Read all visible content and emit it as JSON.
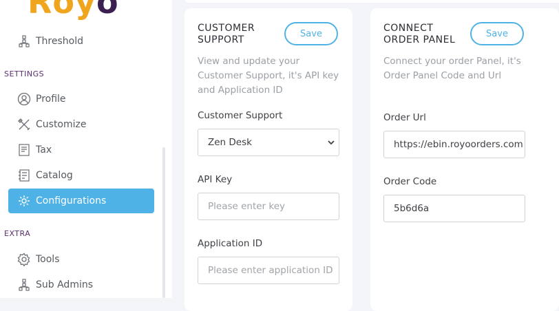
{
  "sidebar": {
    "logo": {
      "text_main": "Roy",
      "text_end": "o"
    },
    "items_top": [
      {
        "label": "Threshold",
        "icon": "threshold-icon"
      }
    ],
    "settings_title": "SETTINGS",
    "settings_items": [
      {
        "label": "Profile",
        "icon": "profile-icon"
      },
      {
        "label": "Customize",
        "icon": "customize-icon"
      },
      {
        "label": "Tax",
        "icon": "tax-icon"
      },
      {
        "label": "Catalog",
        "icon": "catalog-icon"
      },
      {
        "label": "Configurations",
        "icon": "configurations-icon",
        "active": true
      }
    ],
    "extra_title": "EXTRA",
    "extra_items": [
      {
        "label": "Tools",
        "icon": "tools-icon"
      },
      {
        "label": "Sub Admins",
        "icon": "sub-admins-icon"
      }
    ]
  },
  "customer_support": {
    "title": "CUSTOMER SUPPORT",
    "save_label": "Save",
    "description": "View and update your Customer Support, it's API key and Application ID",
    "support_label": "Customer Support",
    "support_value": "Zen Desk",
    "api_key_label": "API Key",
    "api_key_placeholder": "Please enter key",
    "app_id_label": "Application ID",
    "app_id_placeholder": "Please enter application ID"
  },
  "order_panel": {
    "title": "CONNECT ORDER PANEL",
    "save_label": "Save",
    "description": "Connect your order Panel, it's Order Panel Code and Url",
    "order_url_label": "Order Url",
    "order_url_value": "https://ebin.royoorders.com",
    "order_code_label": "Order Code",
    "order_code_value": "5b6d6a"
  },
  "colors": {
    "accent": "#4fb2e6",
    "section": "#5a2c6e",
    "logo": "#f0a51e"
  }
}
